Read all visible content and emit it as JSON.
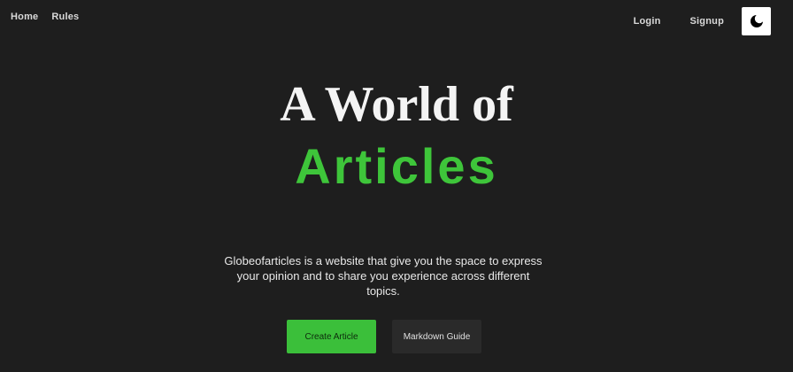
{
  "nav": {
    "home_label": "Home",
    "rules_label": "Rules",
    "login_label": "Login",
    "signup_label": "Signup",
    "theme_toggle_icon": "moon-icon"
  },
  "hero": {
    "title_line1": "A World of",
    "title_line2": "Articles",
    "description": "Globeofarticles is a website that give you the space to express your opinion and to share you experience across different topics."
  },
  "actions": {
    "create_label": "Create Article",
    "guide_label": "Markdown Guide"
  },
  "colors": {
    "background": "#1e1e1e",
    "accent": "#3ec53a",
    "text": "#f4f4f4"
  }
}
